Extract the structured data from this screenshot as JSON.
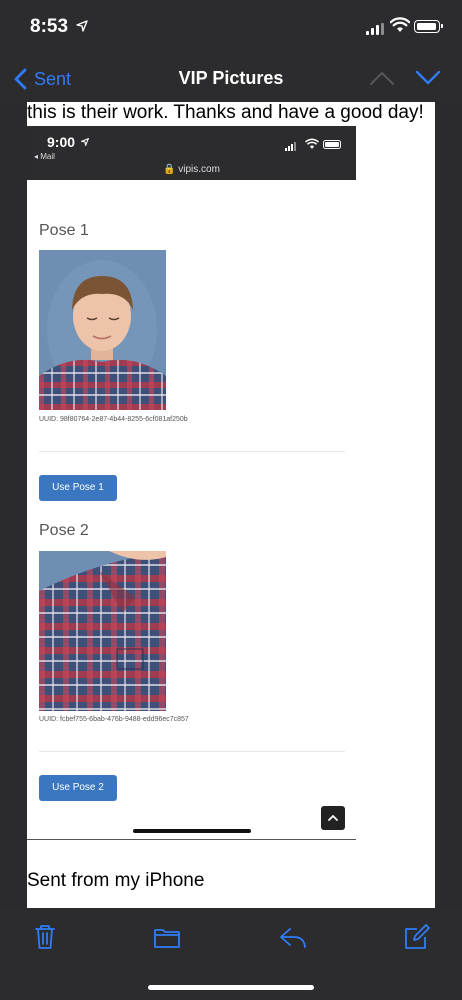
{
  "status_bar": {
    "time": "8:53",
    "location_icon": "location-arrow-icon",
    "signal_icon": "cellular-signal-icon",
    "wifi_icon": "wifi-icon",
    "battery_icon": "battery-icon"
  },
  "nav": {
    "back_label": "Sent",
    "title": "VIP Pictures",
    "up_icon": "chevron-up-icon",
    "down_icon": "chevron-down-icon"
  },
  "colors": {
    "accent": "#2f7cf6",
    "bar_background": "#2c2c2e",
    "pose_button": "#3a77c0"
  },
  "message": {
    "body_line": "this is their work. Thanks and have a good day!",
    "signature": "Sent from my iPhone"
  },
  "embedded_screenshot": {
    "time": "9:00",
    "back_label": "◂ Mail",
    "url": "🔒 vipis.com",
    "poses": [
      {
        "heading": "Pose 1",
        "uuid": "UUID: 98f80764-2e87-4b44-8255-6cf081af250b",
        "button_label": "Use Pose 1"
      },
      {
        "heading": "Pose 2",
        "uuid": "UUID: fcbef755-6bab-476b-9488-edd96ec7c857",
        "button_label": "Use Pose 2"
      }
    ],
    "scroll_top_icon": "chevron-up-icon"
  },
  "toolbar": {
    "trash_icon": "trash-icon",
    "folder_icon": "folder-icon",
    "reply_icon": "reply-icon",
    "compose_icon": "compose-icon"
  }
}
